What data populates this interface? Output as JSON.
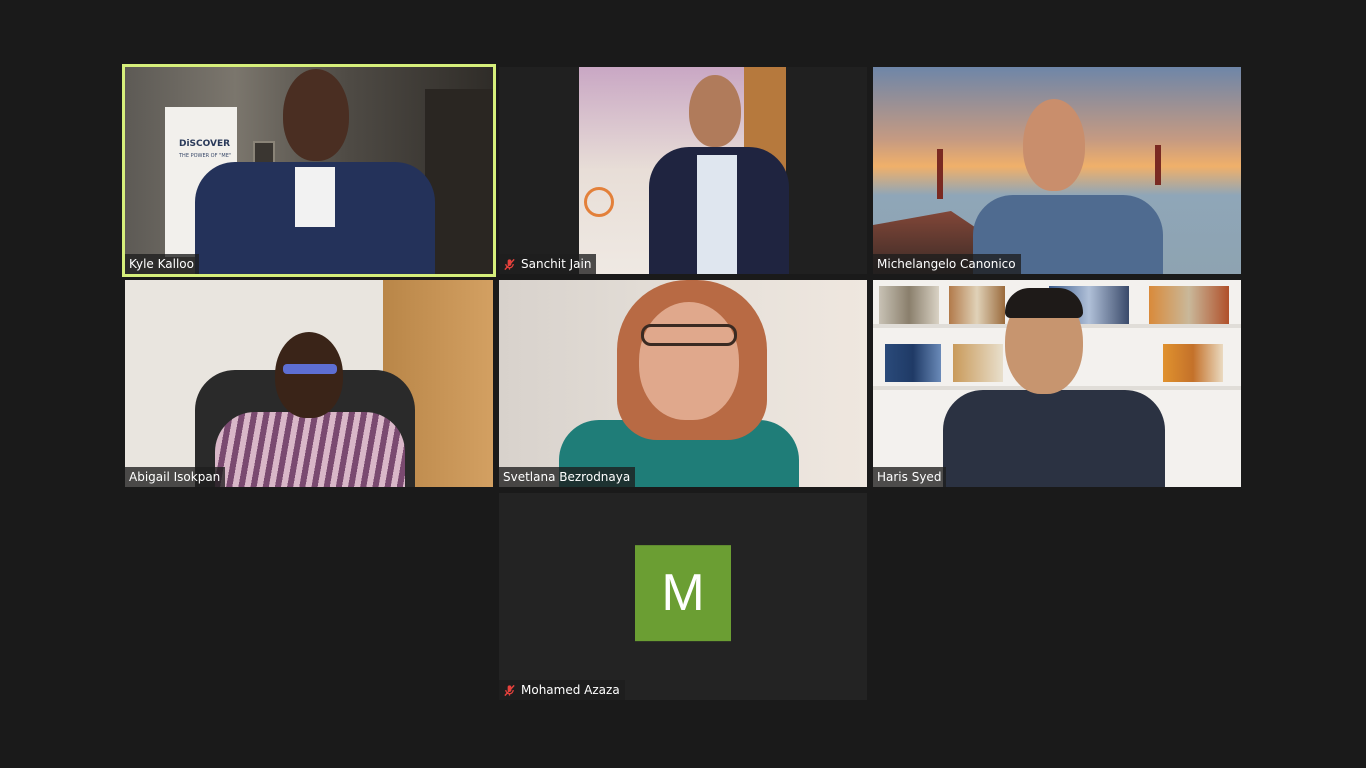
{
  "meeting": {
    "participants": [
      {
        "name": "Kyle Kalloo",
        "muted": false,
        "active_speaker": true,
        "video_on": true
      },
      {
        "name": "Sanchit Jain",
        "muted": true,
        "active_speaker": false,
        "video_on": true
      },
      {
        "name": "Michelangelo Canonico",
        "muted": false,
        "active_speaker": false,
        "video_on": true
      },
      {
        "name": "Abigail Isokpan",
        "muted": false,
        "active_speaker": false,
        "video_on": true
      },
      {
        "name": "Svetlana Bezrodnaya",
        "muted": false,
        "active_speaker": false,
        "video_on": true
      },
      {
        "name": "Haris Syed",
        "muted": false,
        "active_speaker": false,
        "video_on": true
      },
      {
        "name": "Mohamed Azaza",
        "muted": true,
        "active_speaker": false,
        "video_on": false,
        "avatar_letter": "M"
      }
    ],
    "backdrop_text": {
      "banner": "DiSCOVER",
      "banner_sub": "THE POWER OF \"ME\""
    }
  },
  "colors": {
    "background": "#1a1a1a",
    "tile_background": "#232323",
    "active_speaker_border": "#d6ef7b",
    "muted_icon": "#e5413c",
    "avatar_green": "#6b9e33"
  },
  "icons": {
    "muted": "mic-muted-icon"
  }
}
